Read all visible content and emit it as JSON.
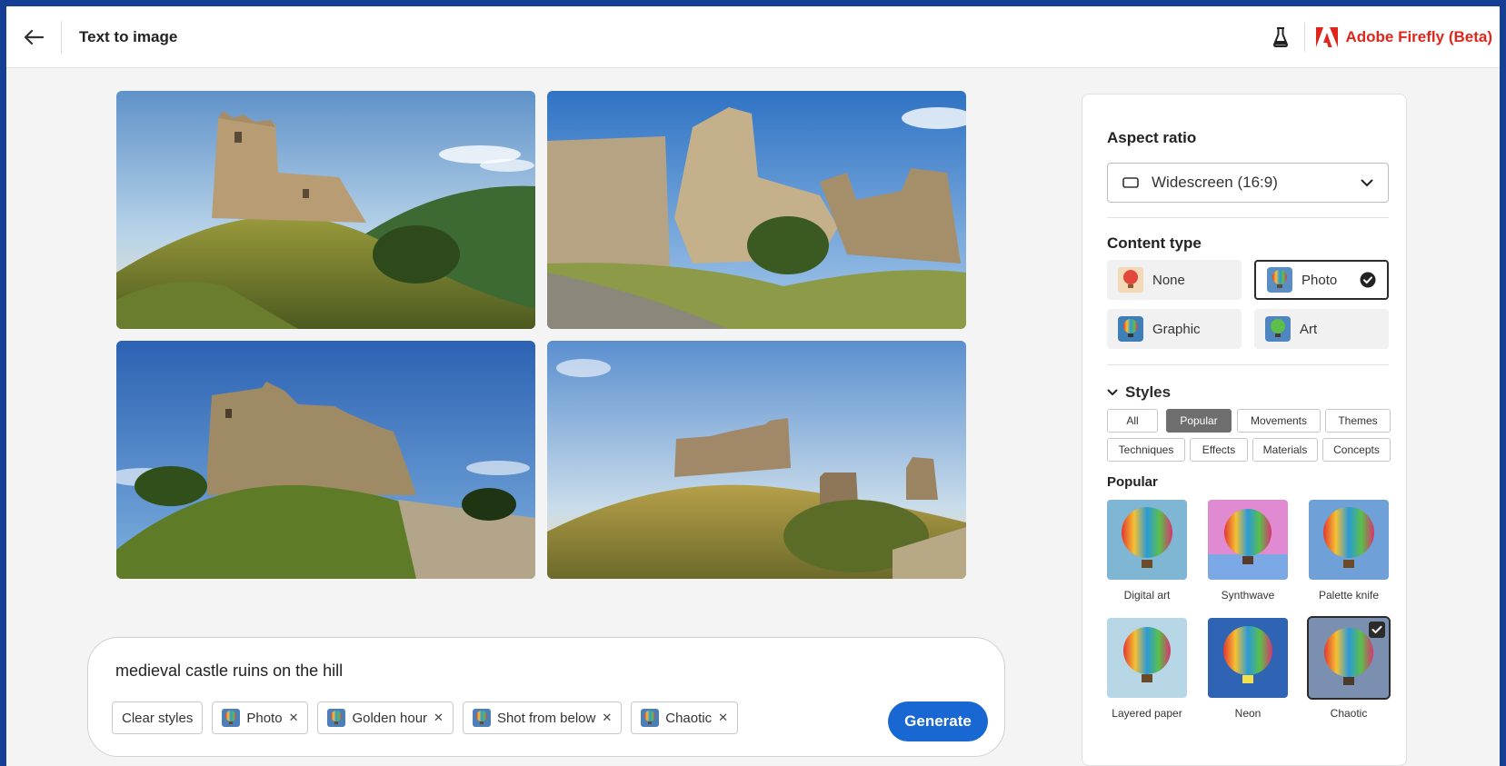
{
  "header": {
    "title": "Text to image",
    "brand": "Adobe Firefly (Beta)",
    "brand_color": "#e1251b"
  },
  "icons": [
    "back-arrow-icon",
    "beaker-icon",
    "adobe-logo-icon",
    "widescreen-icon",
    "chevron-down-icon",
    "checkmark-icon",
    "close-icon"
  ],
  "prompt": {
    "text": "medieval castle ruins on the hill",
    "clear_label": "Clear styles",
    "chips": [
      "Photo",
      "Golden hour",
      "Shot from below",
      "Chaotic"
    ],
    "generate_label": "Generate",
    "generate_color": "#1967d2"
  },
  "panel": {
    "aspect_ratio_label": "Aspect ratio",
    "aspect_ratio_value": "Widescreen (16:9)",
    "content_type_label": "Content type",
    "content_types": [
      {
        "label": "None",
        "selected": false
      },
      {
        "label": "Photo",
        "selected": true
      },
      {
        "label": "Graphic",
        "selected": false
      },
      {
        "label": "Art",
        "selected": false
      }
    ],
    "styles_label": "Styles",
    "style_tabs": [
      {
        "label": "All",
        "active": false
      },
      {
        "label": "Popular",
        "active": true
      },
      {
        "label": "Movements",
        "active": false
      },
      {
        "label": "Themes",
        "active": false
      },
      {
        "label": "Techniques",
        "active": false
      },
      {
        "label": "Effects",
        "active": false
      },
      {
        "label": "Materials",
        "active": false
      },
      {
        "label": "Concepts",
        "active": false
      }
    ],
    "popular_label": "Popular",
    "styles": [
      {
        "label": "Digital art",
        "selected": false
      },
      {
        "label": "Synthwave",
        "selected": false
      },
      {
        "label": "Palette knife",
        "selected": false
      },
      {
        "label": "Layered paper",
        "selected": false
      },
      {
        "label": "Neon",
        "selected": false
      },
      {
        "label": "Chaotic",
        "selected": true
      }
    ]
  }
}
